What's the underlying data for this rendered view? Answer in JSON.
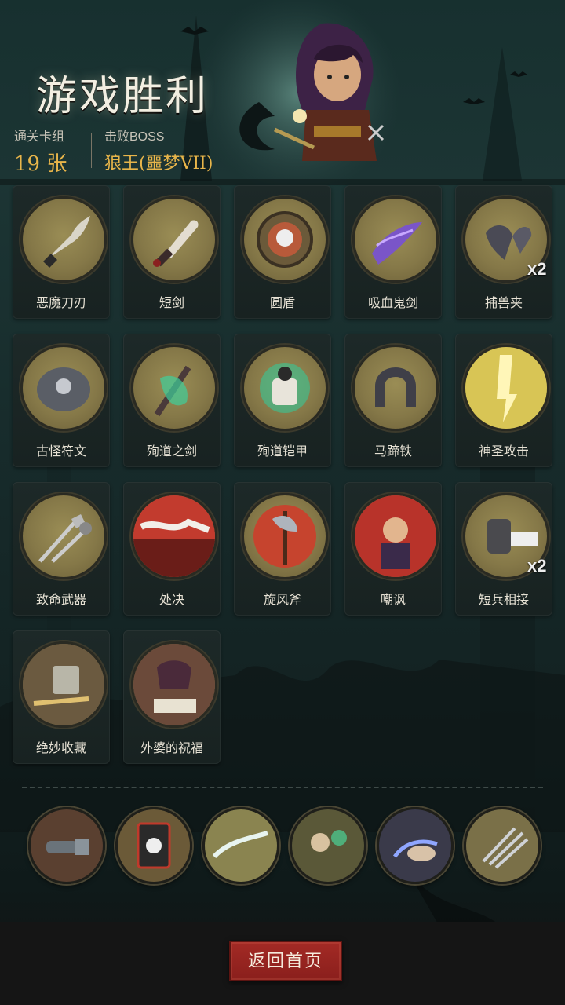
{
  "header": {
    "title": "游戏胜利",
    "deck_label": "通关卡组",
    "deck_count": "19 张",
    "boss_label": "击败BOSS",
    "boss_name": "狼王(噩梦VII)"
  },
  "cards": [
    {
      "name": "恶魔刀刃",
      "icon": "demon-blade-icon"
    },
    {
      "name": "短剑",
      "icon": "short-sword-icon"
    },
    {
      "name": "圆盾",
      "icon": "round-shield-icon"
    },
    {
      "name": "吸血鬼剑",
      "icon": "vampire-sword-icon"
    },
    {
      "name": "捕兽夹",
      "icon": "bear-trap-icon",
      "badge": "x2"
    },
    {
      "name": "古怪符文",
      "icon": "strange-rune-icon"
    },
    {
      "name": "殉道之剑",
      "icon": "martyr-sword-icon"
    },
    {
      "name": "殉道铠甲",
      "icon": "martyr-armor-icon"
    },
    {
      "name": "马蹄铁",
      "icon": "horseshoe-icon"
    },
    {
      "name": "神圣攻击",
      "icon": "holy-strike-icon"
    },
    {
      "name": "致命武器",
      "icon": "deadly-weapons-icon"
    },
    {
      "name": "处决",
      "icon": "execution-icon"
    },
    {
      "name": "旋风斧",
      "icon": "whirlwind-axe-icon"
    },
    {
      "name": "嘲讽",
      "icon": "taunt-icon"
    },
    {
      "name": "短兵相接",
      "icon": "close-combat-icon",
      "badge": "x2"
    },
    {
      "name": "绝妙收藏",
      "icon": "fine-collection-icon"
    },
    {
      "name": "外婆的祝福",
      "icon": "grandma-blessing-icon"
    }
  ],
  "relics": [
    {
      "icon": "cannon-relic-icon"
    },
    {
      "icon": "skull-card-relic-icon"
    },
    {
      "icon": "slash-relic-icon"
    },
    {
      "icon": "zombie-relic-icon"
    },
    {
      "icon": "hand-relic-icon"
    },
    {
      "icon": "knives-relic-icon"
    }
  ],
  "footer": {
    "return_label": "返回首页"
  },
  "colors": {
    "gold": "#e8b54a",
    "button_red": "#a32a25",
    "disc": "#857848"
  }
}
